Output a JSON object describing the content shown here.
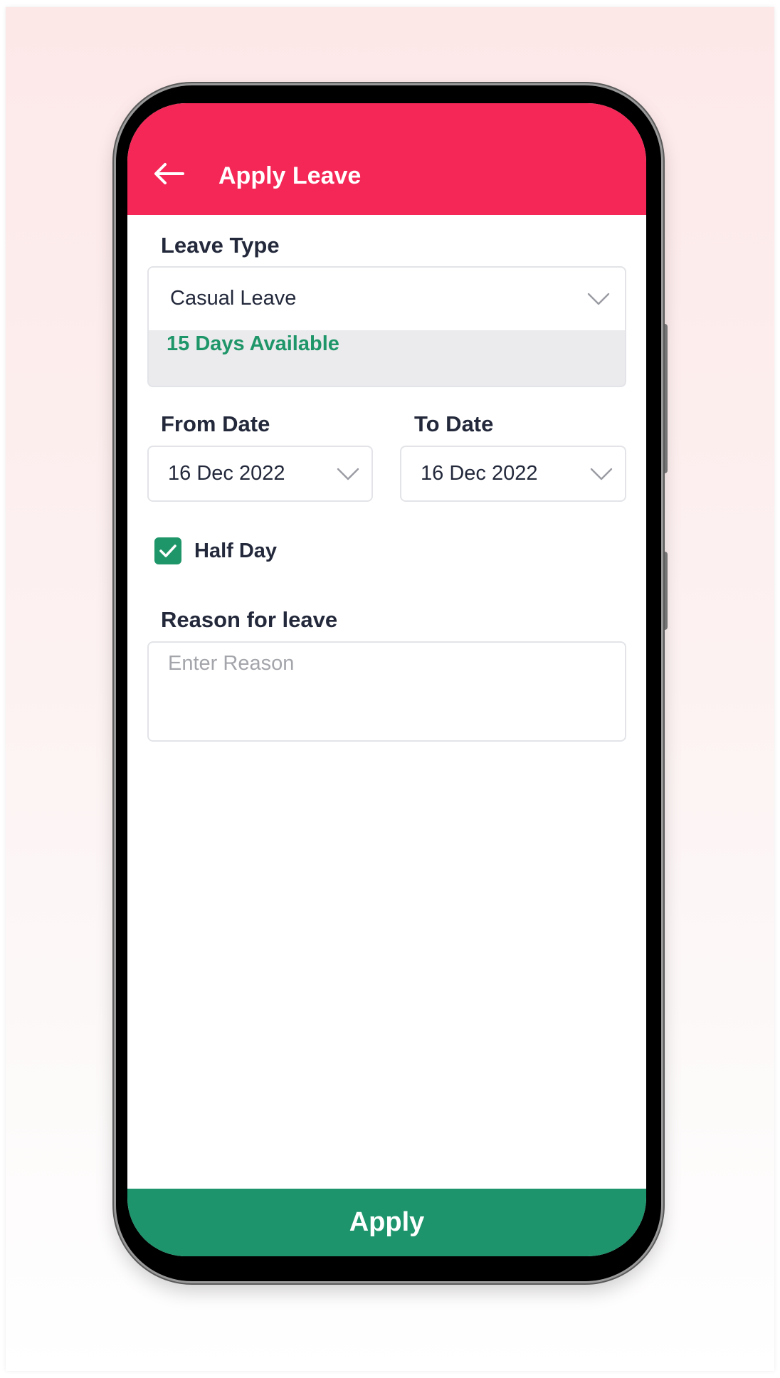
{
  "header": {
    "title": "Apply Leave",
    "back_icon": "arrow-left-icon"
  },
  "form": {
    "leave_type": {
      "label": "Leave Type",
      "value": "Casual Leave",
      "available": "15 Days Available"
    },
    "from_date": {
      "label": "From Date",
      "value": "16 Dec 2022"
    },
    "to_date": {
      "label": "To Date",
      "value": "16 Dec 2022"
    },
    "half_day": {
      "label": "Half Day",
      "checked": true
    },
    "reason": {
      "label": "Reason for leave",
      "placeholder": "Enter Reason"
    }
  },
  "footer": {
    "apply_label": "Apply"
  },
  "colors": {
    "header": "#f42756",
    "accent_green": "#1f9669",
    "apply_button": "#1d946b",
    "text_dark": "#23293b"
  }
}
